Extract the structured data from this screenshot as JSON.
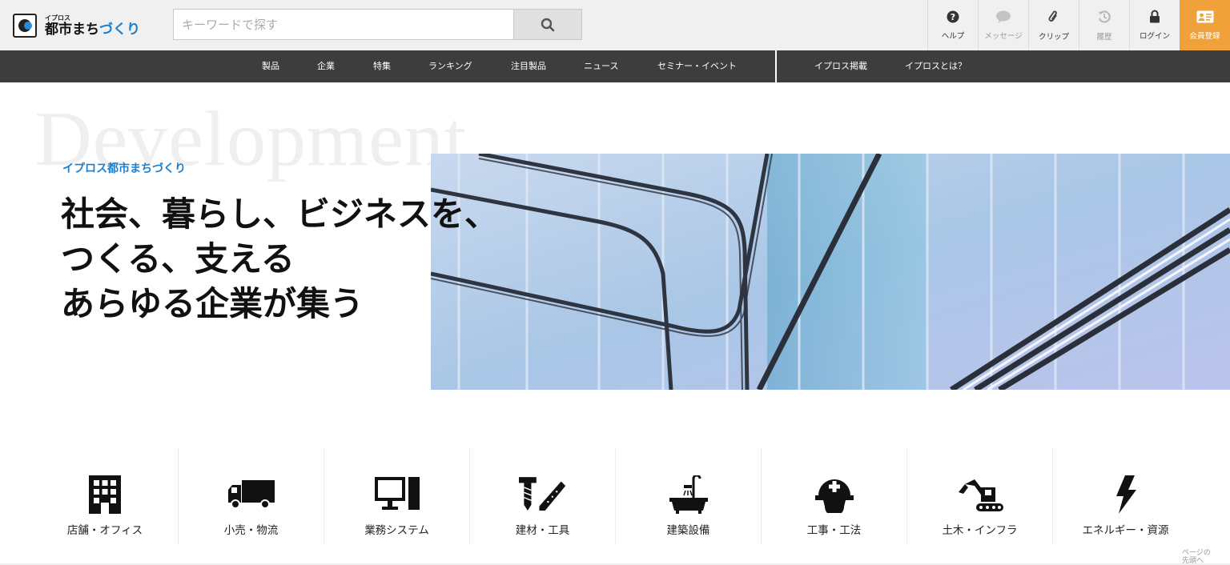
{
  "logo": {
    "small": "イプロス",
    "main_a": "都市まち",
    "main_b": "づくり"
  },
  "search": {
    "placeholder": "キーワードで探す",
    "icon": "search-icon"
  },
  "header_nav": [
    {
      "label": "ヘルプ",
      "icon": "question-circle-icon"
    },
    {
      "label": "メッセージ",
      "icon": "speech-bubble-icon"
    },
    {
      "label": "クリップ",
      "icon": "paperclip-icon"
    },
    {
      "label": "履歴",
      "icon": "history-icon"
    },
    {
      "label": "ログイン",
      "icon": "lock-icon"
    },
    {
      "label": "会員登録",
      "icon": "id-card-icon"
    }
  ],
  "navbar": {
    "main": [
      "製品",
      "企業",
      "特集",
      "ランキング",
      "注目製品",
      "ニュース",
      "セミナー・イベント"
    ],
    "sub": [
      "イプロス掲載",
      "イプロスとは？"
    ]
  },
  "hero": {
    "bg_word": "Development",
    "subtitle": "イプロス都市まちづくり",
    "title": "社会、暮らし、ビジネスを、\nつくる、支える\nあらゆる企業が集う"
  },
  "categories": [
    {
      "label": "店舗・オフィス",
      "icon": "office-building-icon"
    },
    {
      "label": "小売・物流",
      "icon": "truck-icon"
    },
    {
      "label": "業務システム",
      "icon": "computer-icon"
    },
    {
      "label": "建材・工具",
      "icon": "tools-icon"
    },
    {
      "label": "建築設備",
      "icon": "bathtub-icon"
    },
    {
      "label": "工事・工法",
      "icon": "hard-hat-icon"
    },
    {
      "label": "土木・インフラ",
      "icon": "excavator-icon"
    },
    {
      "label": "エネルギー・資源",
      "icon": "lightning-icon"
    }
  ],
  "page_top": {
    "line1": "ページの",
    "line2": "先頭へ"
  },
  "colors": {
    "accent": "#1a7fcf",
    "register": "#f0a13a",
    "navbar": "#3d3d3d"
  }
}
